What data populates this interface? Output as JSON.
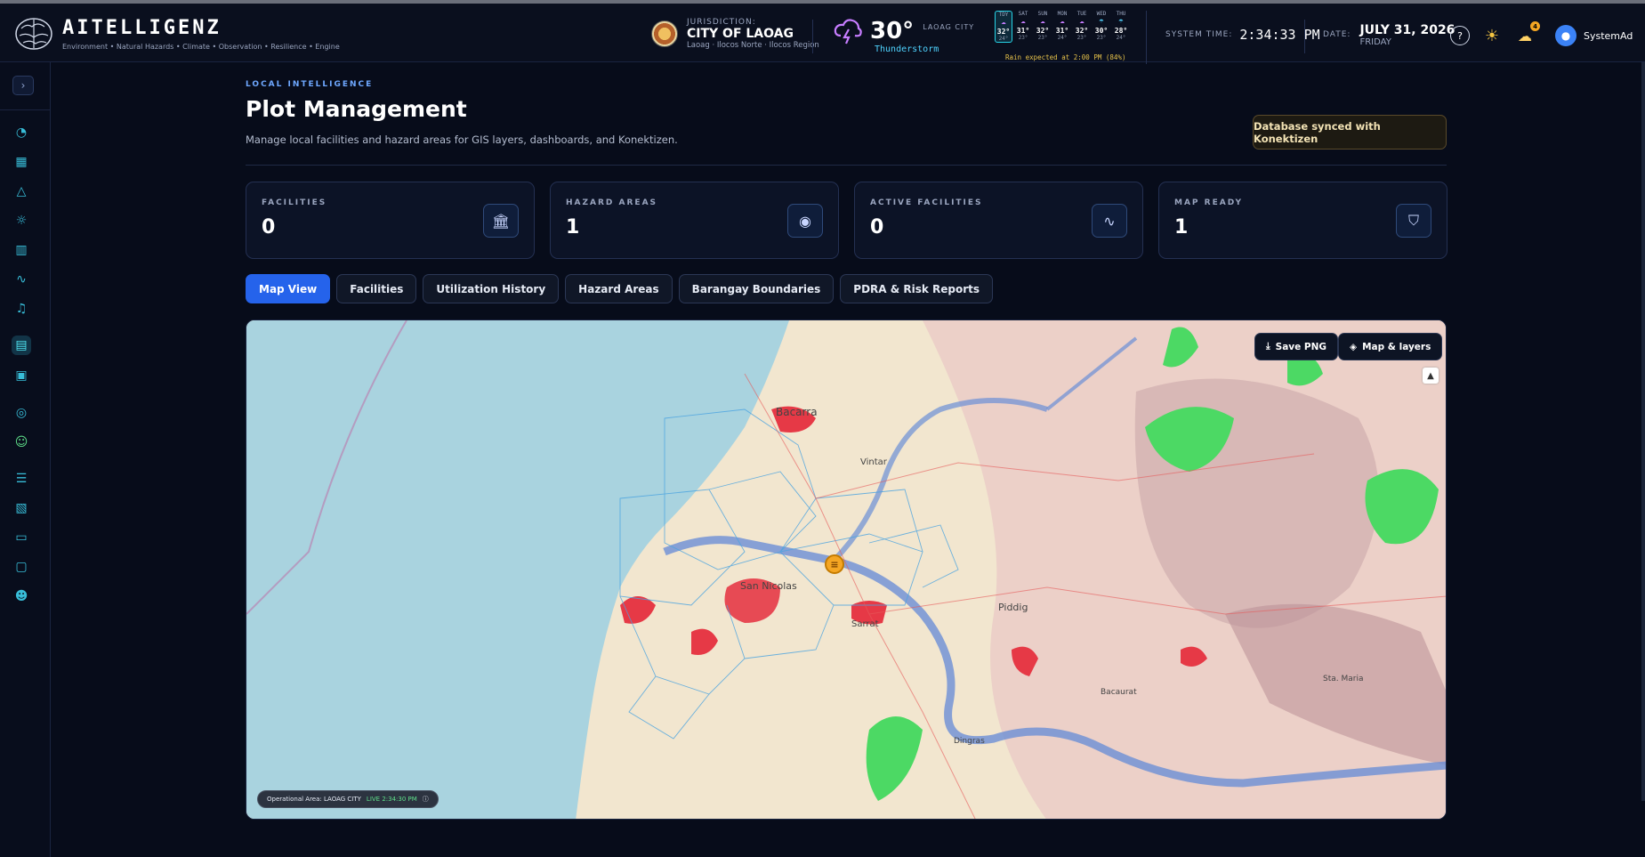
{
  "app": {
    "name": "AITELLIGENZ",
    "tagline": "Environment • Natural Hazards • Climate • Observation • Resilience • Engine"
  },
  "jurisdiction": {
    "label": "JURISDICTION:",
    "city": "CITY OF LAOAG",
    "sub": "Laoag · Ilocos Norte · Ilocos Region"
  },
  "weather": {
    "temp": "30°",
    "city": "LAOAG CITY",
    "condition": "Thunderstorm",
    "forecast": [
      {
        "day": "TDY",
        "hi": "32°",
        "lo": "24°",
        "icon": "storm-icon"
      },
      {
        "day": "SAT",
        "hi": "31°",
        "lo": "23°",
        "icon": "storm-icon"
      },
      {
        "day": "SUN",
        "hi": "32°",
        "lo": "23°",
        "icon": "storm-icon"
      },
      {
        "day": "MON",
        "hi": "31°",
        "lo": "24°",
        "icon": "storm-icon"
      },
      {
        "day": "TUE",
        "hi": "32°",
        "lo": "23°",
        "icon": "storm-icon"
      },
      {
        "day": "WED",
        "hi": "30°",
        "lo": "23°",
        "icon": "rain-icon"
      },
      {
        "day": "THU",
        "hi": "28°",
        "lo": "24°",
        "icon": "rain-icon"
      }
    ],
    "rain_note": "Rain expected at 2:00 PM (84%)"
  },
  "system": {
    "time_label": "SYSTEM TIME:",
    "time": "2:34:33 PM",
    "date_label": "DATE:",
    "date": "JULY 31, 2026",
    "day": "FRIDAY",
    "notif_count": "4"
  },
  "user": {
    "name": "SystemAd"
  },
  "page": {
    "eyebrow": "LOCAL INTELLIGENCE",
    "title": "Plot Management",
    "description": "Manage local facilities and hazard areas for GIS layers, dashboards, and Konektizen.",
    "sync_badge": "Database synced with Konektizen"
  },
  "stats": [
    {
      "label": "FACILITIES",
      "value": "0",
      "icon": "building-icon"
    },
    {
      "label": "HAZARD AREAS",
      "value": "1",
      "icon": "map-pin-icon"
    },
    {
      "label": "ACTIVE FACILITIES",
      "value": "0",
      "icon": "activity-icon"
    },
    {
      "label": "MAP READY",
      "value": "1",
      "icon": "shield-icon"
    }
  ],
  "tabs": [
    {
      "label": "Map View",
      "active": true
    },
    {
      "label": "Facilities"
    },
    {
      "label": "Utilization History"
    },
    {
      "label": "Hazard Areas"
    },
    {
      "label": "Barangay Boundaries"
    },
    {
      "label": "PDRA & Risk Reports"
    }
  ],
  "map": {
    "save_png": "Save PNG",
    "layers": "Map & layers",
    "op_area": "Operational Area: LAOAG CITY",
    "live": "LIVE 2:34:30 PM",
    "places": [
      "Bacarra",
      "Vintar",
      "San Nicolas",
      "Sarrat",
      "Piddig",
      "Dingras",
      "Bacaurat",
      "Sta. Maria"
    ]
  },
  "colors": {
    "accent": "#2563eb",
    "cyan": "#38bdd8",
    "sea": "#a9d3df",
    "hazard": "#e63946"
  }
}
